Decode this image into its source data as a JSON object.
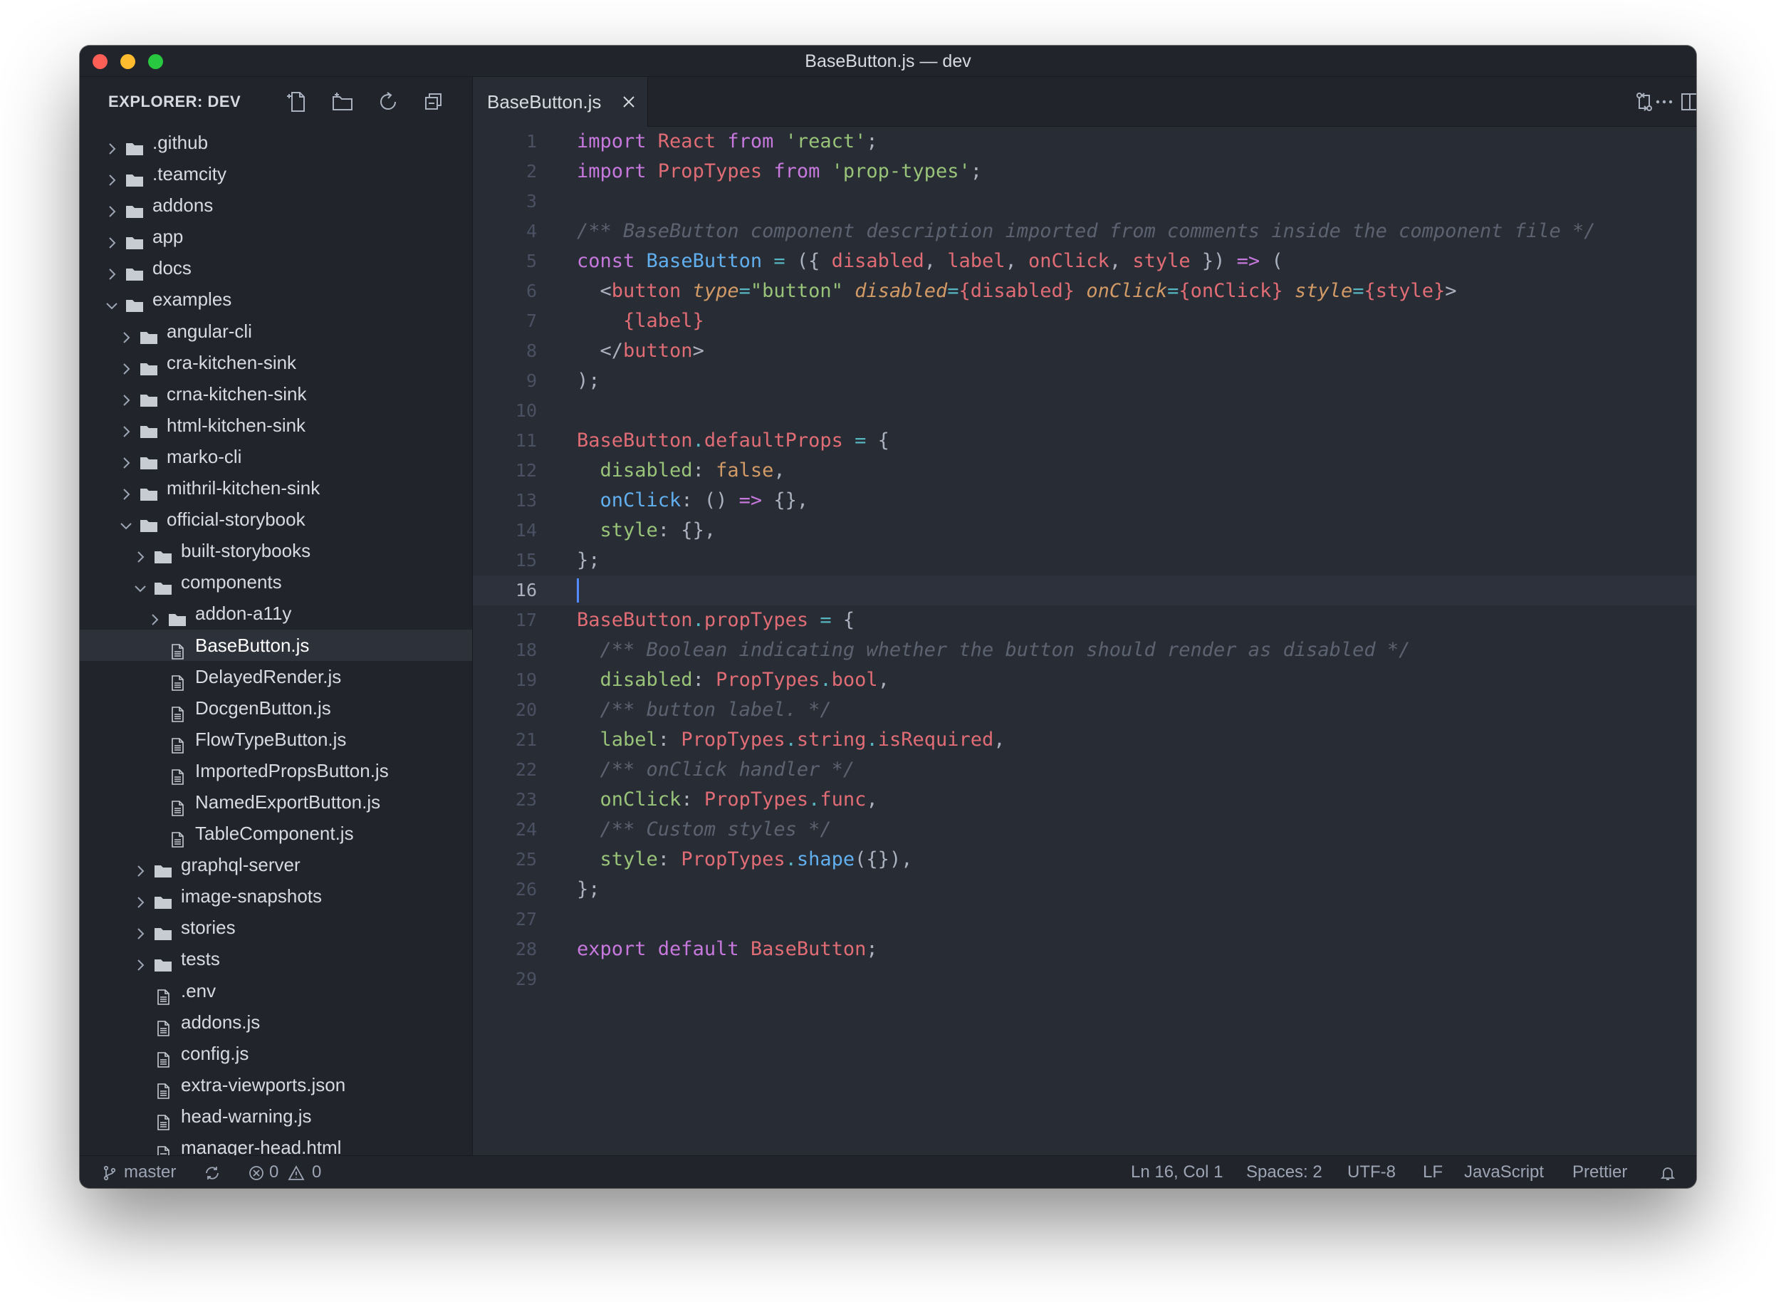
{
  "window": {
    "title": "BaseButton.js — dev"
  },
  "sidebar": {
    "title": "EXPLORER: DEV",
    "actions": [
      "new-file-icon",
      "new-folder-icon",
      "refresh-icon",
      "collapse-all-icon"
    ],
    "items": [
      {
        "label": ".github",
        "type": "folder",
        "depth": 0,
        "expanded": false
      },
      {
        "label": ".teamcity",
        "type": "folder",
        "depth": 0,
        "expanded": false
      },
      {
        "label": "addons",
        "type": "folder",
        "depth": 0,
        "expanded": false
      },
      {
        "label": "app",
        "type": "folder",
        "depth": 0,
        "expanded": false
      },
      {
        "label": "docs",
        "type": "folder",
        "depth": 0,
        "expanded": false
      },
      {
        "label": "examples",
        "type": "folder",
        "depth": 0,
        "expanded": true
      },
      {
        "label": "angular-cli",
        "type": "folder",
        "depth": 1,
        "expanded": false
      },
      {
        "label": "cra-kitchen-sink",
        "type": "folder",
        "depth": 1,
        "expanded": false
      },
      {
        "label": "crna-kitchen-sink",
        "type": "folder",
        "depth": 1,
        "expanded": false
      },
      {
        "label": "html-kitchen-sink",
        "type": "folder",
        "depth": 1,
        "expanded": false
      },
      {
        "label": "marko-cli",
        "type": "folder",
        "depth": 1,
        "expanded": false
      },
      {
        "label": "mithril-kitchen-sink",
        "type": "folder",
        "depth": 1,
        "expanded": false
      },
      {
        "label": "official-storybook",
        "type": "folder",
        "depth": 1,
        "expanded": true
      },
      {
        "label": "built-storybooks",
        "type": "folder",
        "depth": 2,
        "expanded": false
      },
      {
        "label": "components",
        "type": "folder",
        "depth": 2,
        "expanded": true
      },
      {
        "label": "addon-a11y",
        "type": "folder",
        "depth": 3,
        "expanded": false
      },
      {
        "label": "BaseButton.js",
        "type": "file",
        "depth": 3,
        "selected": true
      },
      {
        "label": "DelayedRender.js",
        "type": "file",
        "depth": 3
      },
      {
        "label": "DocgenButton.js",
        "type": "file",
        "depth": 3
      },
      {
        "label": "FlowTypeButton.js",
        "type": "file",
        "depth": 3
      },
      {
        "label": "ImportedPropsButton.js",
        "type": "file",
        "depth": 3
      },
      {
        "label": "NamedExportButton.js",
        "type": "file",
        "depth": 3
      },
      {
        "label": "TableComponent.js",
        "type": "file",
        "depth": 3
      },
      {
        "label": "graphql-server",
        "type": "folder",
        "depth": 2,
        "expanded": false
      },
      {
        "label": "image-snapshots",
        "type": "folder",
        "depth": 2,
        "expanded": false
      },
      {
        "label": "stories",
        "type": "folder",
        "depth": 2,
        "expanded": false
      },
      {
        "label": "tests",
        "type": "folder",
        "depth": 2,
        "expanded": false
      },
      {
        "label": ".env",
        "type": "file",
        "depth": 2
      },
      {
        "label": "addons.js",
        "type": "file",
        "depth": 2
      },
      {
        "label": "config.js",
        "type": "file",
        "depth": 2
      },
      {
        "label": "extra-viewports.json",
        "type": "file",
        "depth": 2
      },
      {
        "label": "head-warning.js",
        "type": "file",
        "depth": 2
      },
      {
        "label": "manager-head.html",
        "type": "file",
        "depth": 2
      }
    ]
  },
  "tabs": [
    {
      "label": "BaseButton.js",
      "active": true
    }
  ],
  "editor_actions": [
    "open-changes-icon",
    "split-editor-icon",
    "more-actions-icon"
  ],
  "editor": {
    "current_line": 16,
    "lines": [
      [
        [
          "k",
          "import "
        ],
        [
          "v",
          "React "
        ],
        [
          "k",
          "from "
        ],
        [
          "s",
          "'react'"
        ],
        [
          "p",
          ";"
        ]
      ],
      [
        [
          "k",
          "import "
        ],
        [
          "v",
          "PropTypes "
        ],
        [
          "k",
          "from "
        ],
        [
          "s",
          "'prop-types'"
        ],
        [
          "p",
          ";"
        ]
      ],
      [],
      [
        [
          "c",
          "/** BaseButton component description imported from comments inside the component file */"
        ]
      ],
      [
        [
          "k",
          "const "
        ],
        [
          "f",
          "BaseButton "
        ],
        [
          "o",
          "= "
        ],
        [
          "p",
          "({ "
        ],
        [
          "v",
          "disabled"
        ],
        [
          "p",
          ", "
        ],
        [
          "v",
          "label"
        ],
        [
          "p",
          ", "
        ],
        [
          "v",
          "onClick"
        ],
        [
          "p",
          ", "
        ],
        [
          "v",
          "style "
        ],
        [
          "p",
          "}) "
        ],
        [
          "k",
          "=> "
        ],
        [
          "p",
          "("
        ]
      ],
      [
        [
          "p",
          "  <"
        ],
        [
          "v",
          "button "
        ],
        [
          "a",
          "type"
        ],
        [
          "o",
          "="
        ],
        [
          "s",
          "\"button\" "
        ],
        [
          "a",
          "disabled"
        ],
        [
          "o",
          "="
        ],
        [
          "v",
          "{disabled} "
        ],
        [
          "a",
          "onClick"
        ],
        [
          "o",
          "="
        ],
        [
          "v",
          "{onClick} "
        ],
        [
          "a",
          "style"
        ],
        [
          "o",
          "="
        ],
        [
          "v",
          "{style}"
        ],
        [
          "p",
          ">"
        ]
      ],
      [
        [
          "v",
          "    {label}"
        ]
      ],
      [
        [
          "p",
          "  </"
        ],
        [
          "v",
          "button"
        ],
        [
          "p",
          ">"
        ]
      ],
      [
        [
          "p",
          ");"
        ]
      ],
      [],
      [
        [
          "v",
          "BaseButton"
        ],
        [
          "o",
          "."
        ],
        [
          "v",
          "defaultProps "
        ],
        [
          "o",
          "= "
        ],
        [
          "p",
          "{"
        ]
      ],
      [
        [
          "s",
          "  disabled"
        ],
        [
          "p",
          ": "
        ],
        [
          "n",
          "false"
        ],
        [
          "p",
          ","
        ]
      ],
      [
        [
          "f",
          "  onClick"
        ],
        [
          "p",
          ": () "
        ],
        [
          "k",
          "=> "
        ],
        [
          "p",
          "{},"
        ]
      ],
      [
        [
          "s",
          "  style"
        ],
        [
          "p",
          ": {},"
        ]
      ],
      [
        [
          "p",
          "};"
        ]
      ],
      [],
      [
        [
          "v",
          "BaseButton"
        ],
        [
          "o",
          "."
        ],
        [
          "v",
          "propTypes "
        ],
        [
          "o",
          "= "
        ],
        [
          "p",
          "{"
        ]
      ],
      [
        [
          "c",
          "  /** Boolean indicating whether the button should render as disabled */"
        ]
      ],
      [
        [
          "s",
          "  disabled"
        ],
        [
          "p",
          ": "
        ],
        [
          "v",
          "PropTypes"
        ],
        [
          "o",
          "."
        ],
        [
          "v",
          "bool"
        ],
        [
          "p",
          ","
        ]
      ],
      [
        [
          "c",
          "  /** button label. */"
        ]
      ],
      [
        [
          "s",
          "  label"
        ],
        [
          "p",
          ": "
        ],
        [
          "v",
          "PropTypes"
        ],
        [
          "o",
          "."
        ],
        [
          "v",
          "string"
        ],
        [
          "o",
          "."
        ],
        [
          "v",
          "isRequired"
        ],
        [
          "p",
          ","
        ]
      ],
      [
        [
          "c",
          "  /** onClick handler */"
        ]
      ],
      [
        [
          "s",
          "  onClick"
        ],
        [
          "p",
          ": "
        ],
        [
          "v",
          "PropTypes"
        ],
        [
          "o",
          "."
        ],
        [
          "v",
          "func"
        ],
        [
          "p",
          ","
        ]
      ],
      [
        [
          "c",
          "  /** Custom styles */"
        ]
      ],
      [
        [
          "s",
          "  style"
        ],
        [
          "p",
          ": "
        ],
        [
          "v",
          "PropTypes"
        ],
        [
          "o",
          "."
        ],
        [
          "f",
          "shape"
        ],
        [
          "p",
          "({}),"
        ]
      ],
      [
        [
          "p",
          "};"
        ]
      ],
      [],
      [
        [
          "k",
          "export "
        ],
        [
          "k",
          "default "
        ],
        [
          "v",
          "BaseButton"
        ],
        [
          "p",
          ";"
        ]
      ],
      []
    ]
  },
  "statusbar": {
    "branch": "master",
    "errors": "0",
    "warnings": "0",
    "position": "Ln 16, Col 1",
    "spaces": "Spaces: 2",
    "encoding": "UTF-8",
    "eol": "LF",
    "language": "JavaScript",
    "formatter": "Prettier"
  },
  "colors": {
    "keyword": "#c678dd",
    "variable": "#e06c75",
    "string": "#98c379",
    "function": "#61afef",
    "operator": "#56b6c2",
    "comment": "#5c6370",
    "attribute": "#d19a66",
    "cursor": "#528bff"
  }
}
